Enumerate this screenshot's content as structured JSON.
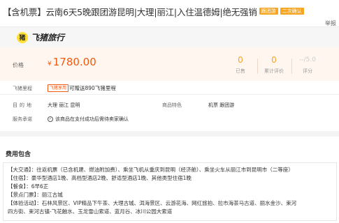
{
  "title": {
    "text": "【含机票】云南6天5晚跟团游昆明|大理|丽江|入住温德姆|绝无强销",
    "badges": [
      "跟团游",
      "二次确认"
    ]
  },
  "report_label": "举报",
  "logo": {
    "mark": "猪",
    "text": "飞猪旅行"
  },
  "price": {
    "label": "价格",
    "currency": "¥",
    "value": "1780.00"
  },
  "stats": [
    {
      "value": "0",
      "label": "已售"
    },
    {
      "value": "0",
      "label": "累计评价"
    },
    {
      "value": "--/5.0",
      "label": "评分"
    }
  ],
  "mileage": {
    "label": "飞猪里程",
    "tag": "飞猪享用",
    "text": "可赠送890飞猪里程"
  },
  "info": {
    "destination_label": "目的地",
    "destination_value": "大理  丽江  昆明",
    "features_label": "商品特色",
    "features_value": "机票  跟团游",
    "service_label": "服务承诺",
    "service_value": "该商品在支付成功后需待卖家确认"
  },
  "section_title": "费用包含",
  "details": [
    "【大交通】：往返机票（已含机建、燃油附加费）、乘坐飞机从重庆到昆明（经济舱）、乘坐火车从丽江市到昆明市（二等座）",
    "【住宿】：豪华型酒店1晚、高档型酒店2晚、舒适型酒店1晚、其他类型住宿1晚",
    "【餐食】：6早6正",
    "【景点门票】：丽江古城",
    "【体验活动】：石林风景区、VIP精品下午茶、大理古城、洱海景区、云游花海、网红旅拍、拉市海茶马古道、丽水金沙、束河",
    "四方街、束河古镇-飞花触水、玉龙雪山索道、蓝月谷、冰川公园大索道"
  ]
}
